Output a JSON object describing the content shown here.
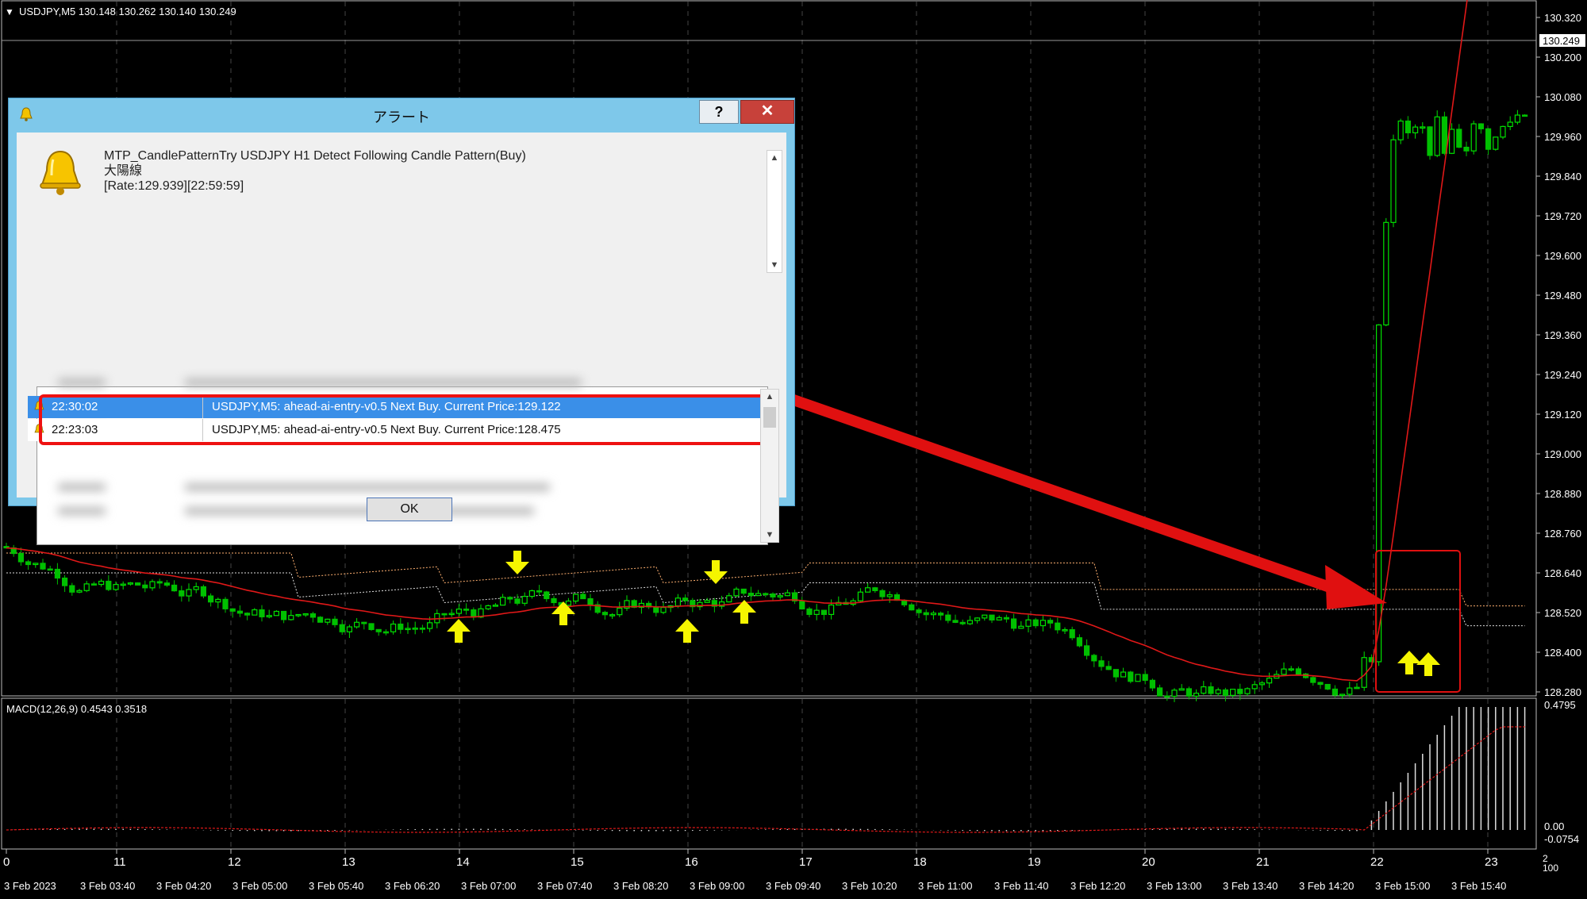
{
  "chart": {
    "header": "USDJPY,M5  130.148 130.262 130.140 130.249",
    "current_price_tag": "130.249",
    "price_axis": [
      "130.320",
      "130.200",
      "130.080",
      "129.960",
      "129.840",
      "129.720",
      "129.600",
      "129.480",
      "129.360",
      "129.240",
      "129.120",
      "129.000",
      "128.880",
      "128.760",
      "128.640",
      "128.520",
      "128.400",
      "128.280"
    ],
    "indicator_label": "MACD(12,26,9) 0.4543 0.3518",
    "indicator_axis": [
      "0.4795",
      "0.00",
      "-0.0754"
    ],
    "hour_labels": [
      "0",
      "11",
      "12",
      "13",
      "14",
      "15",
      "16",
      "17",
      "18",
      "19",
      "20",
      "21",
      "22",
      "23"
    ],
    "date_labels": [
      "3 Feb 2023",
      "3 Feb 03:40",
      "3 Feb 04:20",
      "3 Feb 05:00",
      "3 Feb 05:40",
      "3 Feb 06:20",
      "3 Feb 07:00",
      "3 Feb 07:40",
      "3 Feb 08:20",
      "3 Feb 09:00",
      "3 Feb 09:40",
      "3 Feb 10:20",
      "3 Feb 11:00",
      "3 Feb 11:40",
      "3 Feb 12:20",
      "3 Feb 13:00",
      "3 Feb 13:40",
      "3 Feb 14:20",
      "3 Feb 15:00",
      "3 Feb 15:40"
    ],
    "corner_label": "2\n100",
    "colors": {
      "bull": "#00e000",
      "bear": "#00c000",
      "ma": "#e01818",
      "cloud": "#ffb070",
      "signal": "#f5f500",
      "highlight": "#e01010"
    }
  },
  "dialog": {
    "title": "アラート",
    "help_label": "?",
    "close_label": "✕",
    "message": {
      "line1": "MTP_CandlePatternTry USDJPY H1 Detect Following Candle Pattern(Buy)",
      "line2": "大陽線",
      "line3": "[Rate:129.939][22:59:59]"
    },
    "history": [
      {
        "time": "22:30:02",
        "message": "USDJPY,M5: ahead-ai-entry-v0.5 Next Buy. Current Price:129.122"
      },
      {
        "time": "22:23:03",
        "message": "USDJPY,M5: ahead-ai-entry-v0.5 Next Buy. Current Price:128.475"
      }
    ],
    "ok_label": "OK"
  }
}
